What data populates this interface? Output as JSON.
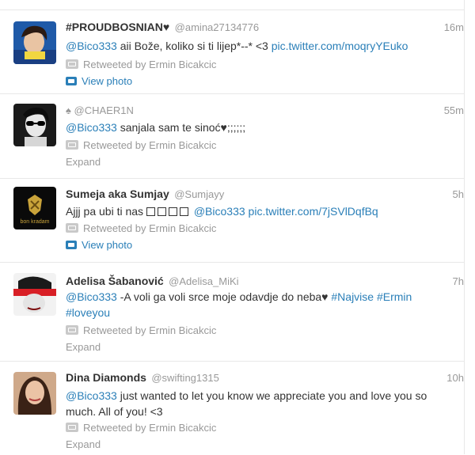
{
  "tweets": [
    {
      "fullname": "#PROUDBOSNIAN♥",
      "username": "@amina27134776",
      "time": "16m",
      "mention": "@Bico333",
      "text_body": " aii Bože, koliko si ti lijep*--* <3 ",
      "link": "pic.twitter.com/moqryYEuko",
      "retweeted_by": "Retweeted by Ermin Bicakcic",
      "action": "View photo",
      "action_type": "photo",
      "avatar_icon": "avatar-girl-blue-scarf"
    },
    {
      "fullname": "",
      "username": "♠ @CHAER1N",
      "time": "55m",
      "mention": "@Bico333",
      "text_body": " sanjala sam te sinoć♥;;;;;;",
      "retweeted_by": "Retweeted by Ermin Bicakcic",
      "action": "Expand",
      "action_type": "expand",
      "avatar_icon": "avatar-bw-sunglasses"
    },
    {
      "fullname": "Sumeja aka Sumjay",
      "username": "@Sumjayy",
      "time": "5h",
      "text_prefix": "Ajjj pa ubi ti nas",
      "mention": "@Bico333",
      "link": "pic.twitter.com/7jSVlDqfBq",
      "retweeted_by": "Retweeted by Ermin Bicakcic",
      "action": "View photo",
      "action_type": "photo",
      "avatar_icon": "avatar-gold-crest",
      "avatar_caption": "bon kradam"
    },
    {
      "fullname": "Adelisa Šabanović",
      "username": "@Adelisa_MiKi",
      "time": "7h",
      "mention": "@Bico333",
      "text_body": " -A voli ga voli srce moje odavdje do neba♥ ",
      "hashtag1": "#Najvise",
      "hashtag2": "#Ermin",
      "hashtag3": "#loveyou",
      "retweeted_by": "Retweeted by Ermin Bicakcic",
      "action": "Expand",
      "action_type": "expand",
      "avatar_icon": "avatar-red-stripe"
    },
    {
      "fullname": "Dina Diamonds",
      "username": "@swifting1315",
      "time": "10h",
      "mention": "@Bico333",
      "text_body": " just wanted to let you know we appreciate you and love you so much. All of you! <3",
      "retweeted_by": "Retweeted by Ermin Bicakcic",
      "action": "Expand",
      "action_type": "expand",
      "avatar_icon": "avatar-brunette"
    }
  ],
  "colors": {
    "link": "#2a7fb8",
    "muted": "#999999",
    "text": "#333333",
    "divider": "#e8e8e8"
  }
}
